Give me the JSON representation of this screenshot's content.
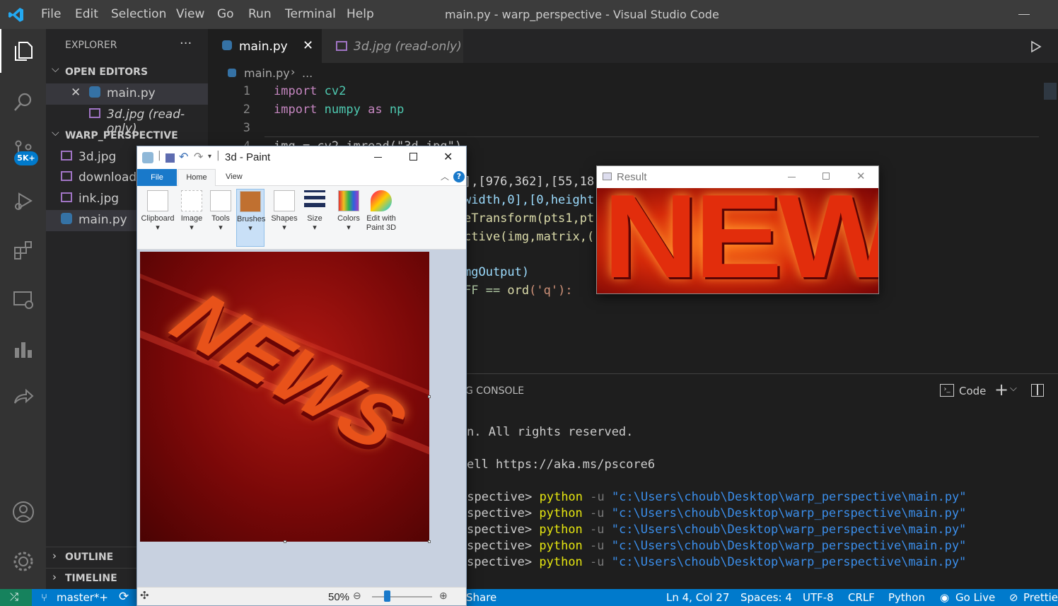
{
  "titlebar": {
    "menu": [
      "File",
      "Edit",
      "Selection",
      "View",
      "Go",
      "Run",
      "Terminal",
      "Help"
    ],
    "title": "main.py - warp_perspective - Visual Studio Code"
  },
  "activity": {
    "badge": "5K+"
  },
  "explorer": {
    "header": "EXPLORER",
    "more": "···",
    "open_editors": "OPEN EDITORS",
    "open_items": [
      "main.py",
      "3d.jpg (read-only)"
    ],
    "project": "WARP_PERSPECTIVE",
    "files": [
      "3d.jpg",
      "download.",
      "ink.jpg",
      "main.py"
    ],
    "outline": "OUTLINE",
    "timeline": "TIMELINE"
  },
  "tabs": [
    {
      "label": "main.py"
    },
    {
      "label": "3d.jpg (read-only)"
    }
  ],
  "breadcrumb": {
    "file": "main.py",
    "rest": "..."
  },
  "code": {
    "line_numbers": [
      "1",
      "2",
      "3",
      "4"
    ],
    "line1": {
      "kw": "import",
      "mod": "cv2"
    },
    "line2": {
      "kw": "import",
      "mod": "numpy",
      "as": "as",
      "alias": "np"
    },
    "line4": "img = cv2.imread(\"3d.jpg\")",
    "frag1": "],[976,362],[55,18",
    "frag2": "width,0],[0,height",
    "frag3": "eTransform(pts1,pt",
    "frag4": "ctive(img,matrix,(",
    "frag5": "mgOutput)",
    "frag6a": "FF == ",
    "frag6b": "ord",
    "frag6c": "('q'):"
  },
  "panel": {
    "tab": "G CONSOLE",
    "profile": "Code",
    "term1": "n. All rights reserved.",
    "term2": "ell https://aka.ms/pscore6",
    "prompt": "spective>",
    "prompt_first": "rspective>",
    "cmd": "python",
    "flag": "-u",
    "path": "\"c:\\Users\\choub\\Desktop\\warp_perspective\\main.py\""
  },
  "statusbar": {
    "branch": "master*+",
    "share": "Share",
    "position": "Ln 4, Col 27",
    "spaces": "Spaces: 4",
    "encoding": "UTF-8",
    "eol": "CRLF",
    "language": "Python",
    "golive": "Go Live",
    "prettier": "Prettie"
  },
  "paint": {
    "title": "3d - Paint",
    "tabs": [
      "File",
      "Home",
      "View"
    ],
    "groups": [
      "Clipboard",
      "Image",
      "Tools",
      "Brushes",
      "Shapes",
      "Size",
      "Colors",
      "Edit with Paint 3D"
    ],
    "zoom": "50%",
    "image_text": "NEWS"
  },
  "result": {
    "title": "Result",
    "image_text": "NEWS"
  },
  "colors": {
    "accent": "#007acc",
    "news_red": "#c8170a",
    "news_orange": "#ff6a00"
  }
}
